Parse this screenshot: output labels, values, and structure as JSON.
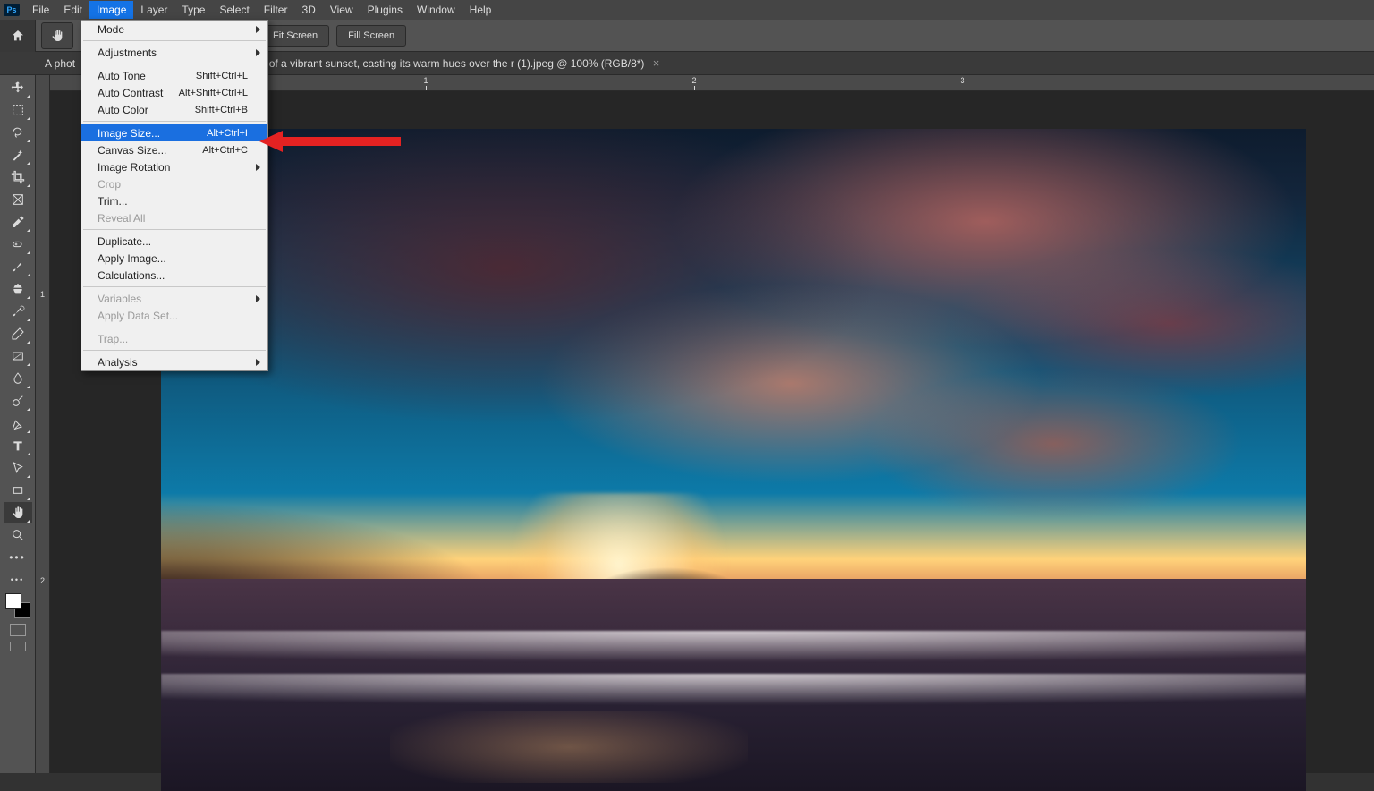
{
  "app": {
    "logo_text": "Ps"
  },
  "menubar": [
    "File",
    "Edit",
    "Image",
    "Layer",
    "Type",
    "Select",
    "Filter",
    "3D",
    "View",
    "Plugins",
    "Window",
    "Help"
  ],
  "active_menu_index": 2,
  "options": {
    "btn_fit_screen": "Fit Screen",
    "btn_fill_screen": "Fill Screen"
  },
  "tab": {
    "title_prefix": "A phot",
    "title_suffix": "of a vibrant sunset, casting its warm hues over the r (1).jpeg @ 100% (RGB/8*)"
  },
  "ruler_h": [
    "",
    "",
    "1",
    "",
    "2",
    "",
    "3"
  ],
  "ruler_v": [
    "",
    "1",
    "",
    "2"
  ],
  "dropdown": {
    "groups": [
      [
        {
          "label": "Mode",
          "submenu": true
        }
      ],
      [
        {
          "label": "Adjustments",
          "submenu": true
        }
      ],
      [
        {
          "label": "Auto Tone",
          "shortcut": "Shift+Ctrl+L"
        },
        {
          "label": "Auto Contrast",
          "shortcut": "Alt+Shift+Ctrl+L"
        },
        {
          "label": "Auto Color",
          "shortcut": "Shift+Ctrl+B"
        }
      ],
      [
        {
          "label": "Image Size...",
          "shortcut": "Alt+Ctrl+I",
          "highlight": true
        },
        {
          "label": "Canvas Size...",
          "shortcut": "Alt+Ctrl+C"
        },
        {
          "label": "Image Rotation",
          "submenu": true
        },
        {
          "label": "Crop",
          "disabled": true
        },
        {
          "label": "Trim..."
        },
        {
          "label": "Reveal All",
          "disabled": true
        }
      ],
      [
        {
          "label": "Duplicate..."
        },
        {
          "label": "Apply Image..."
        },
        {
          "label": "Calculations..."
        }
      ],
      [
        {
          "label": "Variables",
          "submenu": true,
          "disabled": true
        },
        {
          "label": "Apply Data Set...",
          "disabled": true
        }
      ],
      [
        {
          "label": "Trap...",
          "disabled": true
        }
      ],
      [
        {
          "label": "Analysis",
          "submenu": true
        }
      ]
    ]
  },
  "tools": [
    {
      "name": "move-tool"
    },
    {
      "name": "marquee-tool"
    },
    {
      "name": "lasso-tool"
    },
    {
      "name": "magic-wand-tool"
    },
    {
      "name": "crop-tool"
    },
    {
      "name": "frame-tool"
    },
    {
      "name": "eyedropper-tool"
    },
    {
      "name": "healing-brush-tool"
    },
    {
      "name": "brush-tool"
    },
    {
      "name": "clone-stamp-tool"
    },
    {
      "name": "history-brush-tool"
    },
    {
      "name": "eraser-tool"
    },
    {
      "name": "gradient-tool"
    },
    {
      "name": "blur-tool"
    },
    {
      "name": "dodge-tool"
    },
    {
      "name": "pen-tool"
    },
    {
      "name": "type-tool"
    },
    {
      "name": "path-selection-tool"
    },
    {
      "name": "rectangle-tool"
    },
    {
      "name": "hand-tool",
      "selected": true
    },
    {
      "name": "zoom-tool"
    },
    {
      "name": "more-tools"
    },
    {
      "name": "edit-toolbar"
    }
  ]
}
